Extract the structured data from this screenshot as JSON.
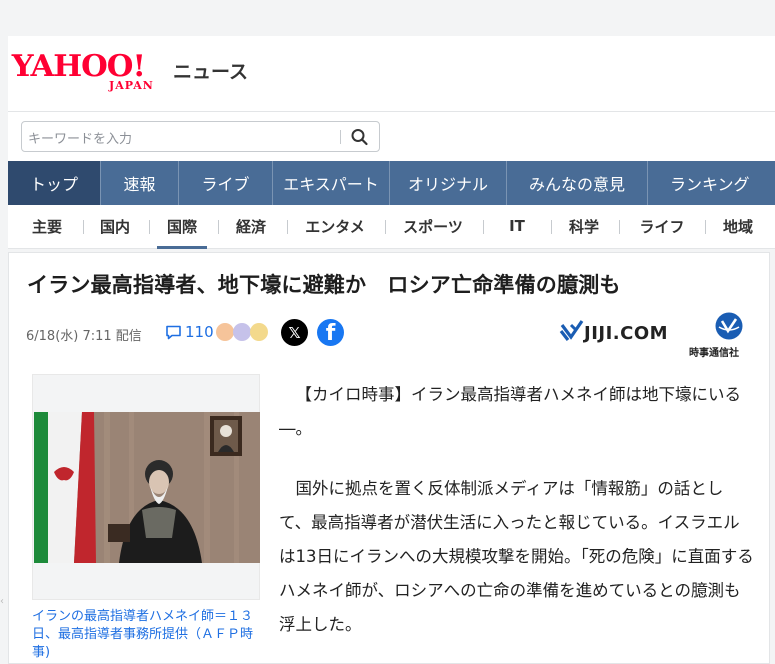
{
  "header": {
    "logo_text": "YAHOO!",
    "logo_sub": "JAPAN",
    "service_name": "ニュース"
  },
  "search": {
    "placeholder": "キーワードを入力",
    "button_icon": "search-icon"
  },
  "global_nav": [
    {
      "label": "トップ",
      "active": true
    },
    {
      "label": "速報"
    },
    {
      "label": "ライブ"
    },
    {
      "label": "エキスパート"
    },
    {
      "label": "オリジナル"
    },
    {
      "label": "みんなの意見"
    },
    {
      "label": "ランキング"
    }
  ],
  "category_nav": [
    {
      "label": "主要"
    },
    {
      "label": "国内"
    },
    {
      "label": "国際",
      "active": true
    },
    {
      "label": "経済"
    },
    {
      "label": "エンタメ"
    },
    {
      "label": "スポーツ"
    },
    {
      "label": "IT"
    },
    {
      "label": "科学"
    },
    {
      "label": "ライフ"
    },
    {
      "label": "地域"
    }
  ],
  "article": {
    "title": "イラン最高指導者、地下壕に避難か　ロシア亡命準備の臆測も",
    "date": "6/18(水) 7:11 配信",
    "comment_count": "110",
    "publisher": "JIJI.COM",
    "publisher_sub": "時事通信社",
    "photo_caption": "イランの最高指導者ハメネイ師＝１３日、最高指導者事務所提供（ＡＦＰ時事)",
    "paragraphs": [
      "【カイロ時事】イラン最高指導者ハメネイ師は地下壕にいる―。",
      "国外に拠点を置く反体制派メディアは「情報筋」の話として、最高指導者が潜伏生活に入ったと報じている。イスラエルは13日にイランへの大規模攻撃を開始。「死の危険」に直面するハメネイ師が、ロシアへの亡命の準備を進めているとの臆測も浮上した。"
    ]
  },
  "colors": {
    "brand_red": "#ff0033",
    "nav_blue": "#496c96",
    "nav_active": "#2f4a6e",
    "link_blue": "#1f6fe2"
  }
}
